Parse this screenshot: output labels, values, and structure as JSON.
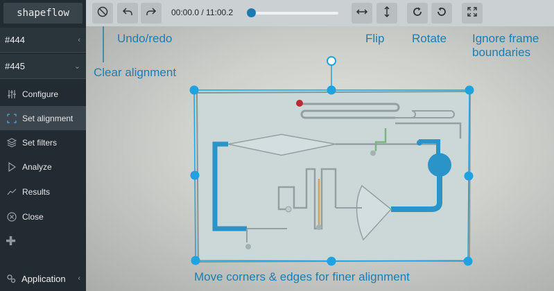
{
  "app": {
    "brand": "shapeflow"
  },
  "sidebar": {
    "dropdowns": [
      {
        "label": "#444"
      },
      {
        "label": "#445"
      }
    ],
    "items": [
      {
        "label": "Configure",
        "icon": "sliders-icon"
      },
      {
        "label": "Set alignment",
        "icon": "frame-corners-icon",
        "active": true
      },
      {
        "label": "Set filters",
        "icon": "layers-icon"
      },
      {
        "label": "Analyze",
        "icon": "play-outline-icon"
      },
      {
        "label": "Results",
        "icon": "line-chart-icon"
      },
      {
        "label": "Close",
        "icon": "close-circle-icon"
      }
    ],
    "footer": {
      "label": "Application",
      "icon": "gears-icon"
    }
  },
  "toolbar": {
    "time": "00:00.0 / 11:00.2",
    "seek_position": 0.0,
    "buttons": [
      "clear-alignment-icon",
      "undo-icon",
      "redo-icon",
      "flip-horizontal-icon",
      "flip-vertical-icon",
      "rotate-cw-icon",
      "rotate-ccw-icon",
      "expand-icon"
    ]
  },
  "annotations": {
    "undo_redo": "Undo/redo",
    "clear_alignment": "Clear alignment",
    "flip": "Flip",
    "rotate": "Rotate",
    "ignore_frame": "Ignore frame\nboundaries",
    "move_corners": "Move corners & edges for finer alignment"
  },
  "colors": {
    "accent": "#1b7bb0",
    "handle": "#1fa3e0",
    "sidebar_bg": "#222b31",
    "annotation": "#1d7db0"
  }
}
